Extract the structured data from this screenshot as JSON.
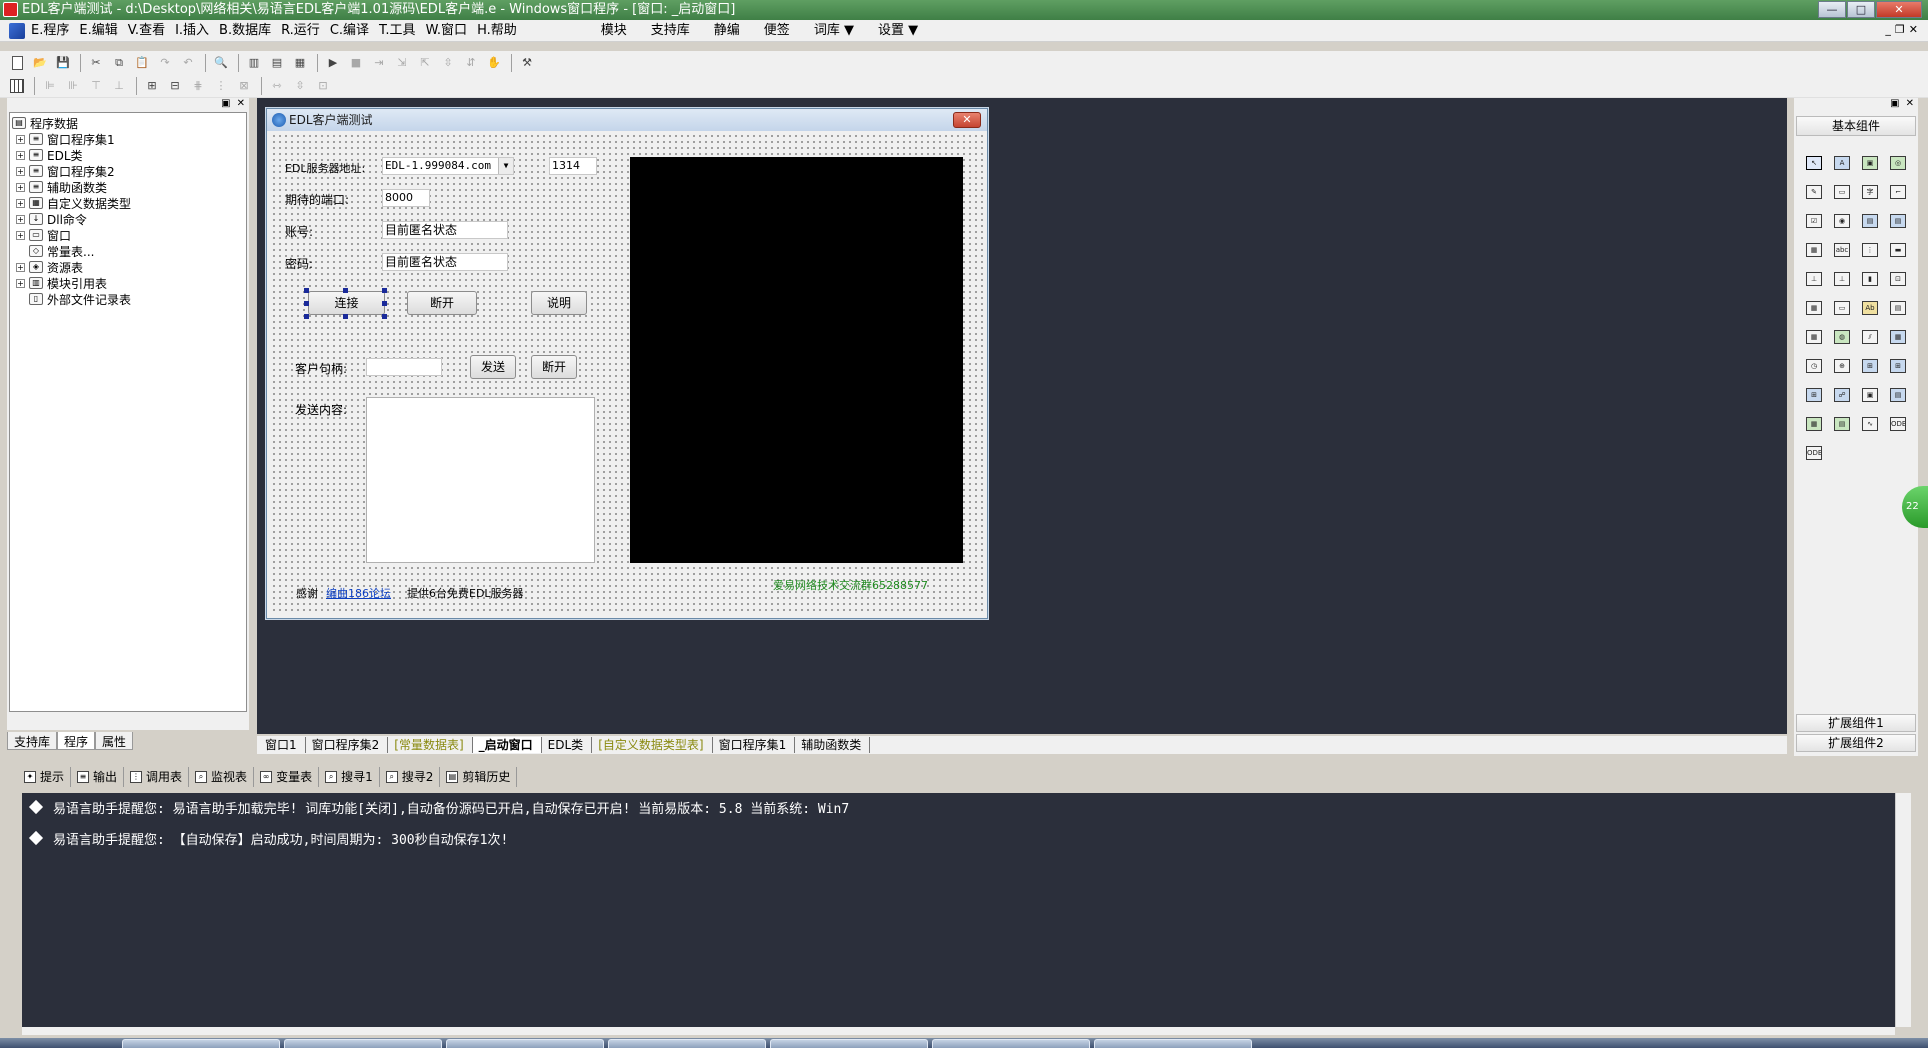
{
  "window": {
    "title": "EDL客户端测试 - d:\\Desktop\\网络相关\\易语言EDL客户端1.01源码\\EDL客户端.e - Windows窗口程序 - [窗口: _启动窗口]",
    "min_label": "—",
    "max_label": "□",
    "close_label": "✕"
  },
  "menu": {
    "items": [
      "E.程序",
      "E.编辑",
      "V.查看",
      "I.插入",
      "B.数据库",
      "R.运行",
      "C.编译",
      "T.工具",
      "W.窗口",
      "H.帮助"
    ],
    "right_items": [
      "模块",
      "支持库",
      "静编",
      "便签",
      "词库 ▼",
      "设置 ▼"
    ],
    "mdi_btns": [
      "_",
      "❐",
      "✕"
    ]
  },
  "left_panel": {
    "root": "程序数据",
    "items": [
      {
        "label": "窗口程序集1",
        "exp": "+"
      },
      {
        "label": "EDL类",
        "exp": "+"
      },
      {
        "label": "窗口程序集2",
        "exp": "+"
      },
      {
        "label": "辅助函数类",
        "exp": "+"
      },
      {
        "label": "自定义数据类型",
        "exp": "+"
      },
      {
        "label": "Dll命令",
        "exp": "+"
      },
      {
        "label": "窗口",
        "exp": "+"
      },
      {
        "label": "常量表...",
        "exp": ""
      },
      {
        "label": "资源表",
        "exp": "+"
      },
      {
        "label": "模块引用表",
        "exp": "+"
      },
      {
        "label": "外部文件记录表",
        "exp": ""
      }
    ],
    "tabs": [
      "支持库",
      "程序",
      "属性"
    ]
  },
  "design_window": {
    "title": "EDL客户端测试",
    "close_label": "✕",
    "server_label": "EDL服务器地址:",
    "server_value": "EDL-1.999084.com",
    "server_port": "1314",
    "port_label": "期待的端口:",
    "port_value": "8000",
    "account_label": "账号:",
    "account_value": "目前匿名状态",
    "password_label": "密码:",
    "password_value": "目前匿名状态",
    "btn_connect": "连接",
    "btn_disconnect": "断开",
    "btn_help": "说明",
    "client_handle_label": "客户句柄:",
    "client_handle_value": "",
    "btn_send": "发送",
    "btn_disconnect2": "断开",
    "send_content_label": "发送内容:",
    "thanks_label": "感谢",
    "forum_link": "编曲186论坛",
    "free_server_text": "提供6台免费EDL服务器",
    "group_text": "爱易网络技术交流群65288577"
  },
  "doc_tabs": [
    {
      "label": "窗口1",
      "style": ""
    },
    {
      "label": "窗口程序集2",
      "style": ""
    },
    {
      "label": "[常量数据表]",
      "style": "olive"
    },
    {
      "label": "_启动窗口",
      "style": "active"
    },
    {
      "label": "EDL类",
      "style": ""
    },
    {
      "label": "[自定义数据类型表]",
      "style": "olive"
    },
    {
      "label": "窗口程序集1",
      "style": ""
    },
    {
      "label": "辅助函数类",
      "style": ""
    }
  ],
  "right_panel": {
    "header": "基本组件",
    "footer1": "扩展组件1",
    "footer2": "扩展组件2",
    "components": [
      "↖",
      "A",
      "▣",
      "◎",
      "✎",
      "▭",
      "字",
      "⌐",
      "☑",
      "◉",
      "▤",
      "▤",
      "▦",
      "abc",
      "⋮",
      "▬",
      "⊥",
      "⊥",
      "▮",
      "⊡",
      "▦",
      "▭",
      "Ab",
      "▤",
      "▦",
      "◍",
      "⫽",
      "▦",
      "◷",
      "⊕",
      "⊞",
      "⊞",
      "⊞",
      "☍",
      "▣",
      "▤",
      "▦",
      "▤",
      "∿",
      "ODBC",
      "ODBC"
    ],
    "float_text": "22"
  },
  "output_tabs": [
    "提示",
    "输出",
    "调用表",
    "监视表",
    "变量表",
    "搜寻1",
    "搜寻2",
    "剪辑历史"
  ],
  "output_lines": [
    "易语言助手提醒您:  易语言助手加载完毕!  词库功能[关闭],自动备份源码已开启,自动保存已开启!  当前易版本: 5.8  当前系统: Win7",
    "易语言助手提醒您: 【自动保存】启动成功,时间周期为: 300秒自动保存1次!"
  ],
  "colors": {
    "titlebar": "#3f7f46",
    "design_bg": "#2b2f3b",
    "link": "#0b3ec2",
    "group_text": "#1e8a1e"
  }
}
